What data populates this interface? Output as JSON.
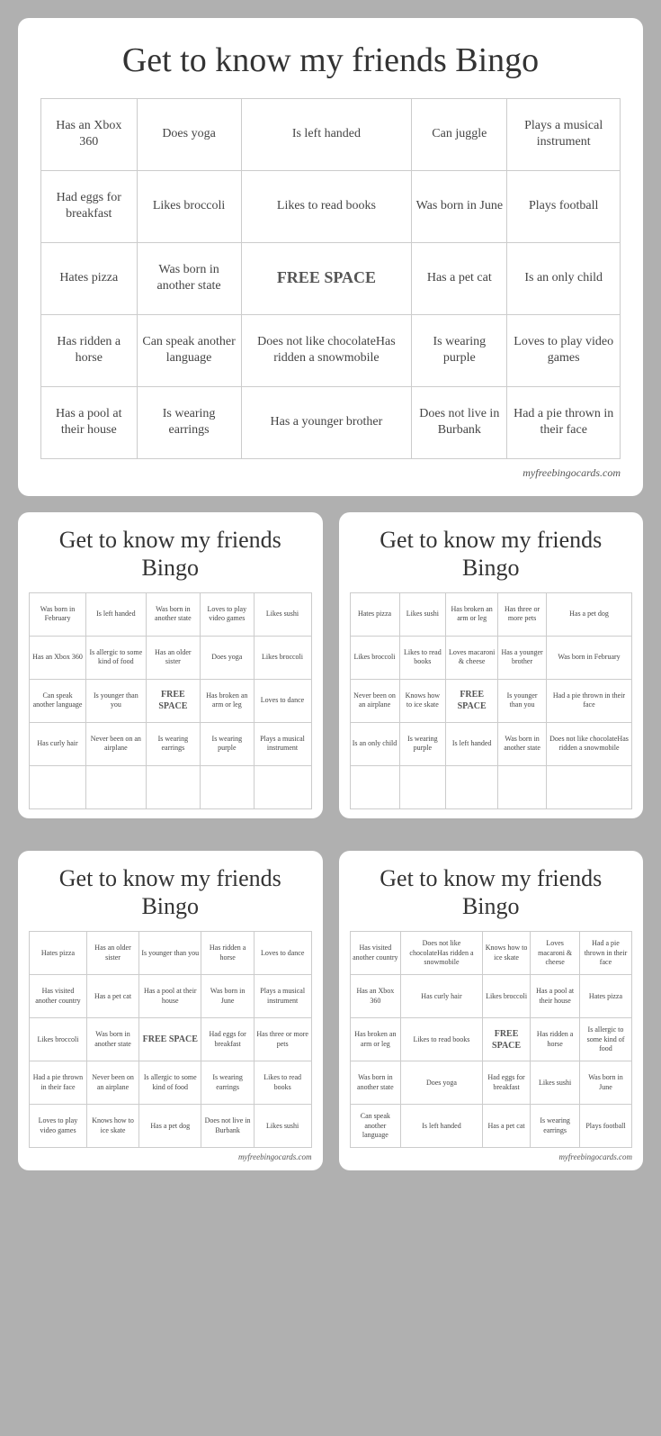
{
  "main_card": {
    "title": "Get to know my friends Bingo",
    "cells": [
      [
        "Has an Xbox 360",
        "Does yoga",
        "Is left handed",
        "Can juggle",
        "Plays a musical instrument"
      ],
      [
        "Had eggs for breakfast",
        "Likes broccoli",
        "Likes to read books",
        "Was born in June",
        "Plays football"
      ],
      [
        "Hates pizza",
        "Was born in another state",
        "FREE SPACE",
        "Has a pet cat",
        "Is an only child"
      ],
      [
        "Has ridden a horse",
        "Can speak another language",
        "Does not like chocolateHas ridden a snowmobile",
        "Is wearing purple",
        "Loves to play video games"
      ],
      [
        "Has a pool at their house",
        "Is wearing earrings",
        "Has a younger brother",
        "Does not live in Burbank",
        "Had a pie thrown in their face"
      ]
    ],
    "free_space_index": [
      2,
      2
    ],
    "credit": "myfreebingocards.com"
  },
  "card2": {
    "title": "Get to know my friends Bingo",
    "cells": [
      [
        "Was born in February",
        "Is left handed",
        "Was born in another state",
        "Loves to play video games",
        "Likes sushi"
      ],
      [
        "Has an Xbox 360",
        "Is allergic to some kind of food",
        "Has an older sister",
        "Does yoga",
        "Likes broccoli"
      ],
      [
        "Can speak another language",
        "Is younger than you",
        "FREE SPACE",
        "Has broken an arm or leg",
        "Loves to dance"
      ],
      [
        "Has curly hair",
        "Never been on an airplane",
        "Is wearing earrings",
        "Is wearing purple",
        "Plays a musical instrument"
      ],
      [
        "",
        "",
        "",
        "",
        ""
      ]
    ],
    "free_space_index": [
      2,
      2
    ],
    "credit": ""
  },
  "card3": {
    "title": "Get to know my friends Bingo",
    "cells": [
      [
        "Hates pizza",
        "Likes sushi",
        "Has broken an arm or leg",
        "Has three or more pets",
        "Has a pet dog"
      ],
      [
        "Likes broccoli",
        "Likes to read books",
        "Loves macaroni & cheese",
        "Has a younger brother",
        "Was born in February"
      ],
      [
        "Never been on an airplane",
        "Knows how to ice skate",
        "FREE SPACE",
        "Is younger than you",
        "Had a pie thrown in their face"
      ],
      [
        "Is an only child",
        "Is wearing purple",
        "Is left handed",
        "Was born in another state",
        "Does not like chocolateHas ridden a snowmobile"
      ],
      [
        "",
        "",
        "",
        "",
        ""
      ]
    ],
    "free_space_index": [
      2,
      2
    ],
    "credit": ""
  },
  "card4": {
    "title": "Get to know my friends Bingo",
    "cells": [
      [
        "Hates pizza",
        "Has an older sister",
        "Is younger than you",
        "Has ridden a horse",
        "Loves to dance"
      ],
      [
        "Has visited another country",
        "Has a pet cat",
        "Has a pool at their house",
        "Was born in June",
        "Plays a musical instrument"
      ],
      [
        "Likes broccoli",
        "Was born in another state",
        "FREE SPACE",
        "Had eggs for breakfast",
        "Has three or more pets"
      ],
      [
        "Had a pie thrown in their face",
        "Never been on an airplane",
        "Is allergic to some kind of food",
        "Is wearing earrings",
        "Likes to read books"
      ],
      [
        "Loves to play video games",
        "Knows how to ice skate",
        "Has a pet dog",
        "Does not live in Burbank",
        "Likes sushi"
      ]
    ],
    "free_space_index": [
      2,
      2
    ],
    "credit": "myfreebingocards.com"
  },
  "card5": {
    "title": "Get to know my friends Bingo",
    "cells": [
      [
        "Has visited another country",
        "Does not like chocolateHas ridden a snowmobile",
        "Knows how to ice skate",
        "Loves macaroni & cheese",
        "Had a pie thrown in their face"
      ],
      [
        "Has an Xbox 360",
        "Has curly hair",
        "Likes broccoli",
        "Has a pool at their house",
        "Hates pizza"
      ],
      [
        "Has broken an arm or leg",
        "Likes to read books",
        "FREE SPACE",
        "Has ridden a horse",
        "Is allergic to some kind of food"
      ],
      [
        "Was born in another state",
        "Does yoga",
        "Had eggs for breakfast",
        "Likes sushi",
        "Was born in June"
      ],
      [
        "Can speak another language",
        "Is left handed",
        "Has a pet cat",
        "Is wearing earrings",
        "Plays football"
      ]
    ],
    "free_space_index": [
      2,
      2
    ],
    "credit": "myfreebingocards.com"
  }
}
